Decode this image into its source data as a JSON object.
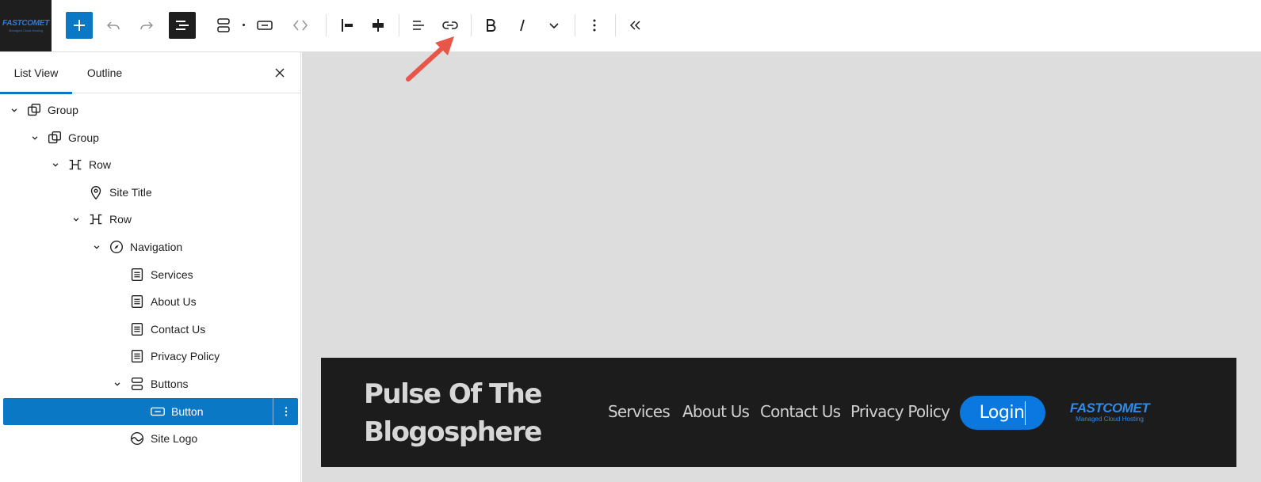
{
  "toolbar": {
    "site_logo_text": "FASTCOMET",
    "site_logo_tagline": "Managed Cloud Hosting",
    "buttons": [
      "add-block",
      "undo",
      "redo",
      "list-view",
      "buttons-block",
      "button-block",
      "move",
      "justify-left",
      "justify-stretch",
      "align",
      "link",
      "bold",
      "italic",
      "more-rich-text",
      "options",
      "collapse"
    ]
  },
  "sidebar": {
    "tabs": [
      {
        "label": "List View",
        "active": true
      },
      {
        "label": "Outline",
        "active": false
      }
    ],
    "tree": [
      {
        "label": "Group",
        "icon": "group-icon",
        "depth": 0,
        "expanded": true
      },
      {
        "label": "Group",
        "icon": "group-icon",
        "depth": 1,
        "expanded": true
      },
      {
        "label": "Row",
        "icon": "row-icon",
        "depth": 2,
        "expanded": true
      },
      {
        "label": "Site Title",
        "icon": "map-marker-icon",
        "depth": 3,
        "expanded": null
      },
      {
        "label": "Row",
        "icon": "row-icon",
        "depth": 3,
        "expanded": true
      },
      {
        "label": "Navigation",
        "icon": "compass-icon",
        "depth": 4,
        "expanded": true
      },
      {
        "label": "Services",
        "icon": "page-icon",
        "depth": 5,
        "expanded": null
      },
      {
        "label": "About Us",
        "icon": "page-icon",
        "depth": 5,
        "expanded": null
      },
      {
        "label": "Contact Us",
        "icon": "page-icon",
        "depth": 5,
        "expanded": null
      },
      {
        "label": "Privacy Policy",
        "icon": "page-icon",
        "depth": 5,
        "expanded": null
      },
      {
        "label": "Buttons",
        "icon": "buttons-icon",
        "depth": 5,
        "expanded": true
      },
      {
        "label": "Button",
        "icon": "button-icon",
        "depth": 6,
        "expanded": null,
        "selected": true
      },
      {
        "label": "Site Logo",
        "icon": "site-logo-icon",
        "depth": 5,
        "expanded": null
      }
    ]
  },
  "canvas": {
    "site_title_line1": "Pulse Of The",
    "site_title_line2": "Blogosphere",
    "nav": [
      "Services",
      "About Us",
      "Contact Us",
      "Privacy Policy"
    ],
    "login_label": "Login",
    "logo_text": "FASTCOMET",
    "logo_tagline": "Managed Cloud Hosting"
  },
  "colors": {
    "accent": "#0b78c6",
    "footer_bg": "#1c1c1c",
    "canvas_bg": "#dddddd",
    "arrow": "#e8564a"
  }
}
